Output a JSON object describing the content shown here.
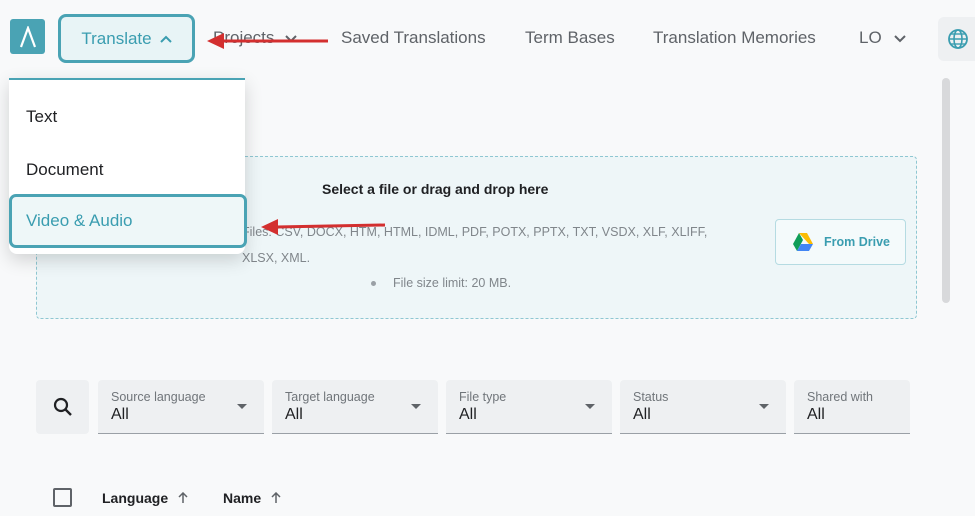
{
  "nav": {
    "translate_label": "Translate",
    "projects_label": "Projects",
    "saved_translations_label": "Saved Translations",
    "term_bases_label": "Term Bases",
    "translation_memories_label": "Translation Memories",
    "user_initials": "LO"
  },
  "translate_menu": {
    "items": [
      {
        "label": "Text"
      },
      {
        "label": "Document"
      },
      {
        "label": "Video & Audio"
      }
    ],
    "selected": "Video & Audio"
  },
  "upload": {
    "title": "Select a file or drag and drop here",
    "supported_types": "Files: CSV, DOCX, HTM, HTML, IDML, PDF, POTX, PPTX, TXT, VSDX, XLF, XLIFF, XLSX, XML.",
    "size_limit": "File size limit: 20 MB.",
    "drive_button": "From Drive"
  },
  "filters": [
    {
      "label": "Source language",
      "value": "All"
    },
    {
      "label": "Target language",
      "value": "All"
    },
    {
      "label": "File type",
      "value": "All"
    },
    {
      "label": "Status",
      "value": "All"
    },
    {
      "label": "Shared with",
      "value": "All"
    }
  ],
  "table": {
    "columns": [
      {
        "label": "Language"
      },
      {
        "label": "Name"
      }
    ]
  },
  "colors": {
    "accent": "#4aa3b4",
    "annotation_arrow": "#d32f2f"
  },
  "icons": {
    "logo": "lambda-logo-icon",
    "globe": "globe-icon",
    "search": "search-icon",
    "drive": "google-drive-icon",
    "sort": "arrow-up-icon"
  }
}
